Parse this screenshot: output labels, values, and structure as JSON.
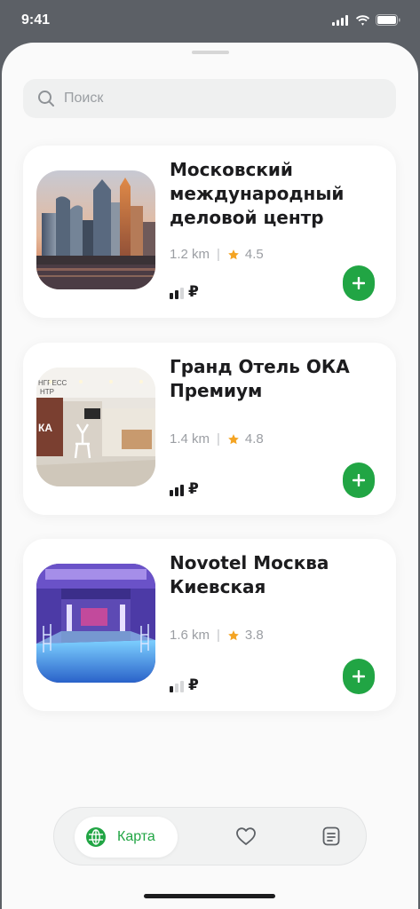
{
  "status_bar": {
    "time": "9:41"
  },
  "search": {
    "placeholder": "Поиск"
  },
  "places": [
    {
      "title": "Московский международный деловой центр",
      "distance": "1.2 km",
      "rating": "4.5",
      "price_level": 2,
      "currency": "₽"
    },
    {
      "title": "Гранд Отель ОКА Премиум",
      "distance": "1.4 km",
      "rating": "4.8",
      "price_level": 3,
      "currency": "₽"
    },
    {
      "title": "Novotel Москва Киевская",
      "distance": "1.6 km",
      "rating": "3.8",
      "price_level": 1,
      "currency": "₽"
    }
  ],
  "tabbar": {
    "active_label": "Карта",
    "tabs": [
      {
        "name": "map",
        "icon": "globe-icon",
        "label": "Карта",
        "active": true
      },
      {
        "name": "favorites",
        "icon": "heart-icon",
        "active": false
      },
      {
        "name": "bookings",
        "icon": "document-icon",
        "active": false
      }
    ]
  },
  "colors": {
    "accent": "#21a544",
    "star": "#f4a423",
    "text": "#1c1c1e",
    "muted": "#9b9ea3",
    "backdrop": "#5c6066"
  }
}
